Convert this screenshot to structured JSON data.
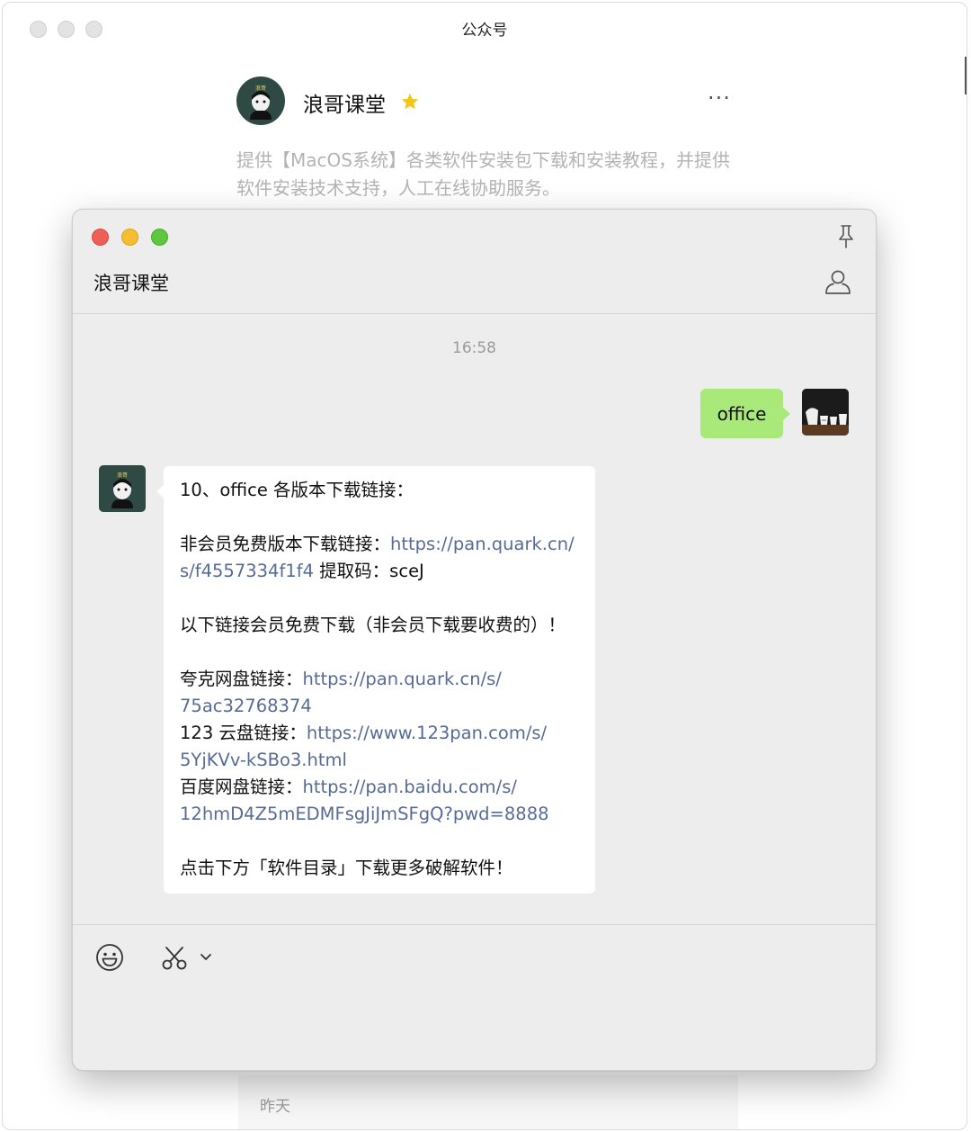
{
  "back_window": {
    "title": "公众号",
    "profile_name": "浪哥课堂",
    "profile_description": "提供【MacOS系统】各类软件安装包下载和安装教程，并提供软件安装技术支持，人工在线协助服务。",
    "history_label": "昨天"
  },
  "chat": {
    "title": "浪哥课堂",
    "timestamp": "16:58",
    "sent_message": "office",
    "received": {
      "line1": "10、office 各版本下载链接：",
      "free_label": "非会员免费版本下载链接：",
      "free_link_part1": "https://pan.quark.cn/",
      "free_link_part2": "s/f4557334f1f4",
      "code_label": " 提取码：sceJ",
      "member_note": "以下链接会员免费下载（非会员下载要收费的）！",
      "quark_label": "夸克网盘链接：",
      "quark_link_part1": "https://pan.quark.cn/s/",
      "quark_link_part2": "75ac32768374",
      "pan123_label": "123 云盘链接：",
      "pan123_link_part1": "https://www.123pan.com/s/",
      "pan123_link_part2": "5YjKVv-kSBo3.html",
      "baidu_label": "百度网盘链接：",
      "baidu_link_part1": "https://pan.baidu.com/s/",
      "baidu_link_part2": "12hmD4Z5mEDMFsgJiJmSFgQ?pwd=8888",
      "footer": "点击下方「软件目录」下载更多破解软件！"
    }
  },
  "colors": {
    "sent_bubble": "#a9e97a",
    "link": "#576b95",
    "traffic_red": "#ee5f57",
    "traffic_yellow": "#f5bd2f",
    "traffic_green": "#5fc73f",
    "star": "#f5c518"
  },
  "icons": [
    "more-icon",
    "star-icon",
    "pin-icon",
    "person-icon",
    "emoji-icon",
    "scissors-icon",
    "chevron-down-icon"
  ]
}
